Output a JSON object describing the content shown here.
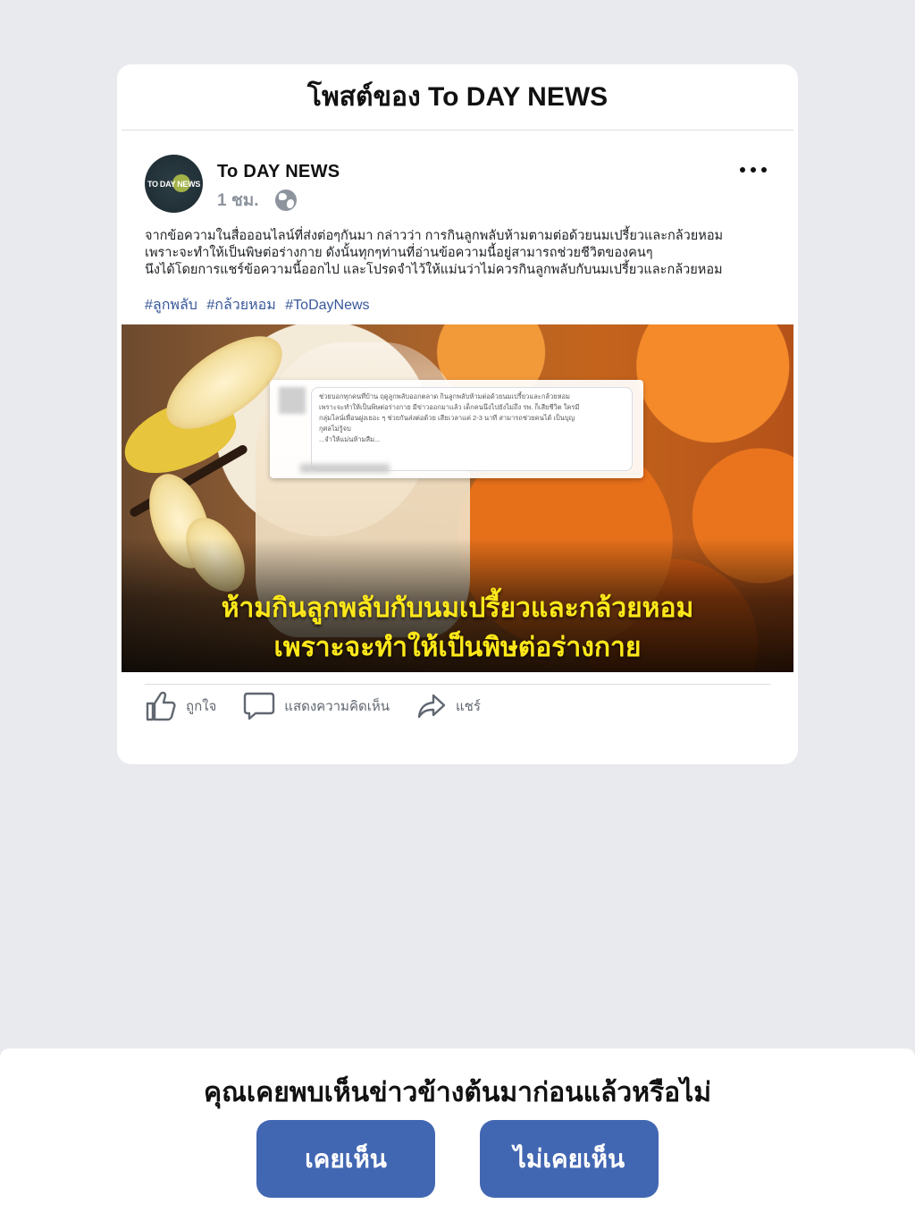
{
  "card": {
    "title": "โพสต์ของ To DAY NEWS"
  },
  "post": {
    "avatar_text": "TO DAY NEWS",
    "author": "To DAY NEWS",
    "time": "1 ชม.",
    "privacy_icon": "globe-icon",
    "more_icon": "more-options-icon",
    "body_lines": [
      "จากข้อความในสื่อออนไลน์ที่ส่งต่อๆกันมา กล่าวว่า การกินลูกพลับห้ามตามต่อด้วยนมเปรี้ยวและกล้วยหอม",
      "เพราะจะทำให้เป็นพิษต่อร่างกาย ดังนั้นทุกๆท่านที่อ่านข้อความนี้อยู่สามารถช่วยชีวิตของคนๆ",
      "นึงได้โดยการแชร์ข้อความนี้ออกไป และโปรดจำไว้ให้แม่นว่าไม่ควรกินลูกพลับกับนมเปรี้ยวและกล้วยหอม"
    ],
    "hashtags": [
      "#ลูกพลับ",
      "#กล้วยหอม",
      "#ToDayNews"
    ],
    "image": {
      "screenshot_lines": [
        "ช่วยบอกทุกคนที่บ้าน ฤดูลูกพลับออกตลาด กินลูกพลับห้ามต่อด้วยนมเปรี้ยวและกล้วยหอม",
        "เพราะจะทำให้เป็นพิษต่อร่างกาย มีข่าวออกมาแล้ว เด็กคนนึงไปยังไม่ถึง รพ. ก็เสียชีวิต ใครมี",
        "กลุ่มไลน์เพื่อนฝูงเยอะ ๆ ช่วยกันส่งต่อด้วย เสียเวลาแค่ 2-3 นาที สามารถช่วยคนได้ เป็นบุญ",
        "กุศลไม่รู้จบ",
        "...จำให้แม่นห้ามลืม..."
      ],
      "caption_lines": [
        "ห้ามกินลูกพลับกับนมเปรี้ยวและกล้วยหอม",
        "เพราะจะทำให้เป็นพิษต่อร่างกาย"
      ]
    },
    "actions": {
      "like": "ถูกใจ",
      "comment": "แสดงความคิดเห็น",
      "share": "แชร์"
    }
  },
  "survey": {
    "question": "คุณเคยพบเห็นข่าวข้างต้นมาก่อนแล้วหรือไม่",
    "yes_label": "เคยเห็น",
    "no_label": "ไม่เคยเห็น"
  },
  "colors": {
    "background": "#e9eaee",
    "button": "#4267b2",
    "hashtag": "#385898",
    "caption": "#ffe81a"
  }
}
